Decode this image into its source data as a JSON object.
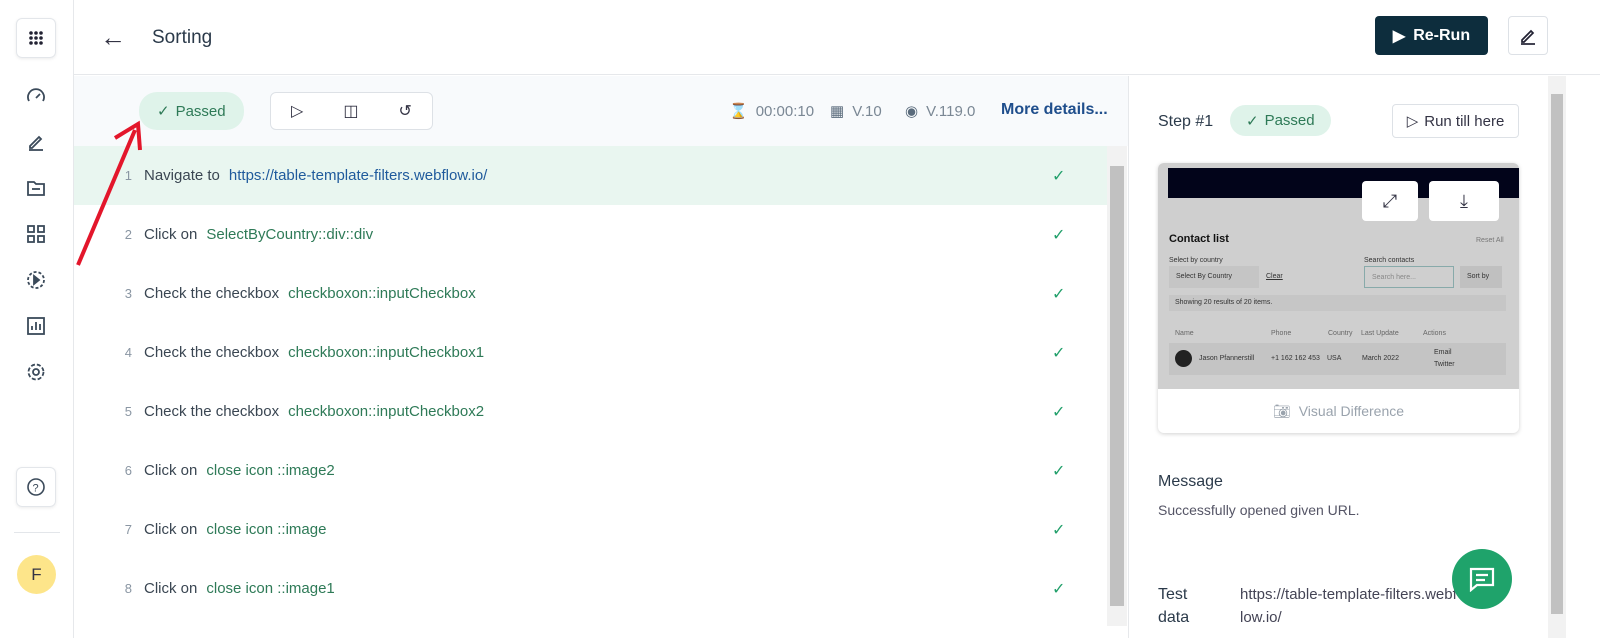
{
  "header": {
    "title": "Sorting",
    "rerun_label": "Re-Run"
  },
  "sidebar": {
    "avatar": "F",
    "items": [
      "dashboard",
      "edit",
      "folder",
      "apps",
      "run",
      "reports",
      "settings"
    ]
  },
  "toolbar": {
    "status": "Passed",
    "duration": "00:00:10",
    "os_version": "V.10",
    "browser_version": "V.119.0",
    "more_details": "More details..."
  },
  "steps": [
    {
      "n": "1",
      "action": "Navigate to",
      "target": "https://table-template-filters.webflow.io/",
      "link": true
    },
    {
      "n": "2",
      "action": "Click on",
      "target": "SelectByCountry::div::div"
    },
    {
      "n": "3",
      "action": "Check the checkbox",
      "target": "checkboxon::inputCheckbox"
    },
    {
      "n": "4",
      "action": "Check the checkbox",
      "target": "checkboxon::inputCheckbox1"
    },
    {
      "n": "5",
      "action": "Check the checkbox",
      "target": "checkboxon::inputCheckbox2"
    },
    {
      "n": "6",
      "action": "Click on",
      "target": "close icon ::image2"
    },
    {
      "n": "7",
      "action": "Click on",
      "target": "close icon ::image"
    },
    {
      "n": "8",
      "action": "Click on",
      "target": "close icon ::image1"
    }
  ],
  "detail": {
    "step_label": "Step #1",
    "status": "Passed",
    "run_till_here": "Run till here",
    "visual_difference": "Visual Difference",
    "screenshot": {
      "heading": "Contact list",
      "reset": "Reset All",
      "select_label": "Select by country",
      "select_value": "Select By Country",
      "clear": "Clear",
      "search_label": "Search contacts",
      "search_placeholder": "Search here...",
      "sort": "Sort by",
      "showing": "Showing 20 results of 20 items.",
      "columns": [
        "Name",
        "Phone",
        "Country",
        "Last Update",
        "Actions"
      ],
      "row": [
        "Jason Pfannerstill",
        "+1 162 162 453",
        "USA",
        "March 2022",
        "Email",
        "Twitter"
      ]
    },
    "message_heading": "Message",
    "message": "Successfully opened given URL.",
    "test_data_label": "Test data",
    "test_data_value": "https://table-template-filters.webflow.io/"
  },
  "colors": {
    "accent": "#0d2d3d",
    "passed": "#2e7a57",
    "check": "#22a06b",
    "annotation_arrow": "#e3162b"
  }
}
